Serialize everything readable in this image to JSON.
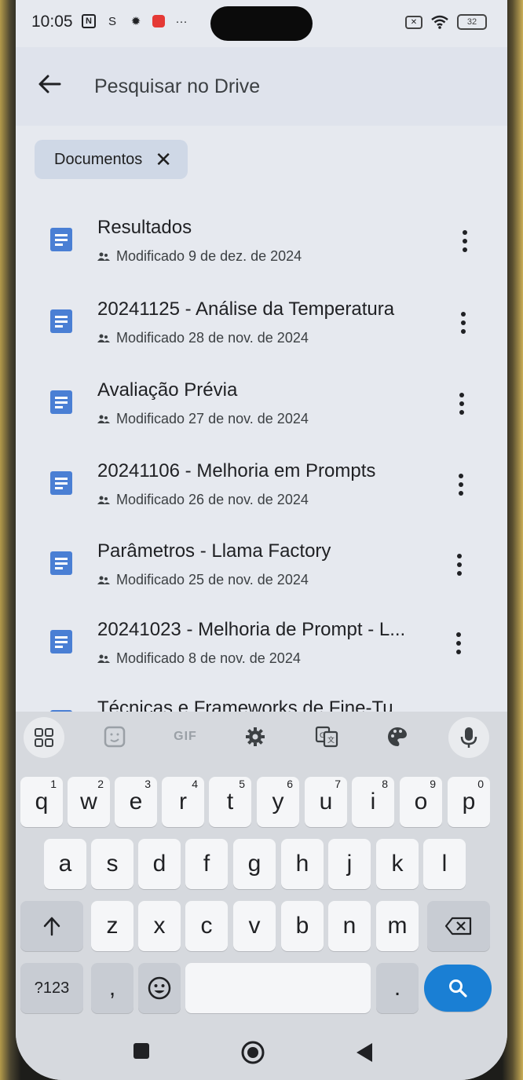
{
  "status_bar": {
    "time": "10:05",
    "battery": "32"
  },
  "search": {
    "placeholder": "Pesquisar no Drive"
  },
  "filter_chip": {
    "label": "Documentos"
  },
  "files": [
    {
      "title": "Resultados",
      "meta": "Modificado 9 de dez. de 2024"
    },
    {
      "title": "20241125 -  Análise da Temperatura",
      "meta": "Modificado 28 de nov. de 2024"
    },
    {
      "title": "Avaliação Prévia",
      "meta": "Modificado 27 de nov. de 2024"
    },
    {
      "title": "20241106 - Melhoria em Prompts",
      "meta": "Modificado 26 de nov. de 2024"
    },
    {
      "title": "Parâmetros - Llama Factory",
      "meta": "Modificado 25 de nov. de 2024"
    },
    {
      "title": "20241023 - Melhoria de Prompt - L...",
      "meta": "Modificado 8 de nov. de 2024"
    },
    {
      "title": "Técnicas e Frameworks de Fine-Tu",
      "meta": ""
    }
  ],
  "keyboard": {
    "toolbar": {
      "gif": "GIF"
    },
    "row1": [
      {
        "k": "q",
        "h": "1"
      },
      {
        "k": "w",
        "h": "2"
      },
      {
        "k": "e",
        "h": "3"
      },
      {
        "k": "r",
        "h": "4"
      },
      {
        "k": "t",
        "h": "5"
      },
      {
        "k": "y",
        "h": "6"
      },
      {
        "k": "u",
        "h": "7"
      },
      {
        "k": "i",
        "h": "8"
      },
      {
        "k": "o",
        "h": "9"
      },
      {
        "k": "p",
        "h": "0"
      }
    ],
    "row2": [
      "a",
      "s",
      "d",
      "f",
      "g",
      "h",
      "j",
      "k",
      "l"
    ],
    "row3": [
      "z",
      "x",
      "c",
      "v",
      "b",
      "n",
      "m"
    ],
    "symbols_key": "?123",
    "comma_key": ",",
    "period_key": "."
  }
}
